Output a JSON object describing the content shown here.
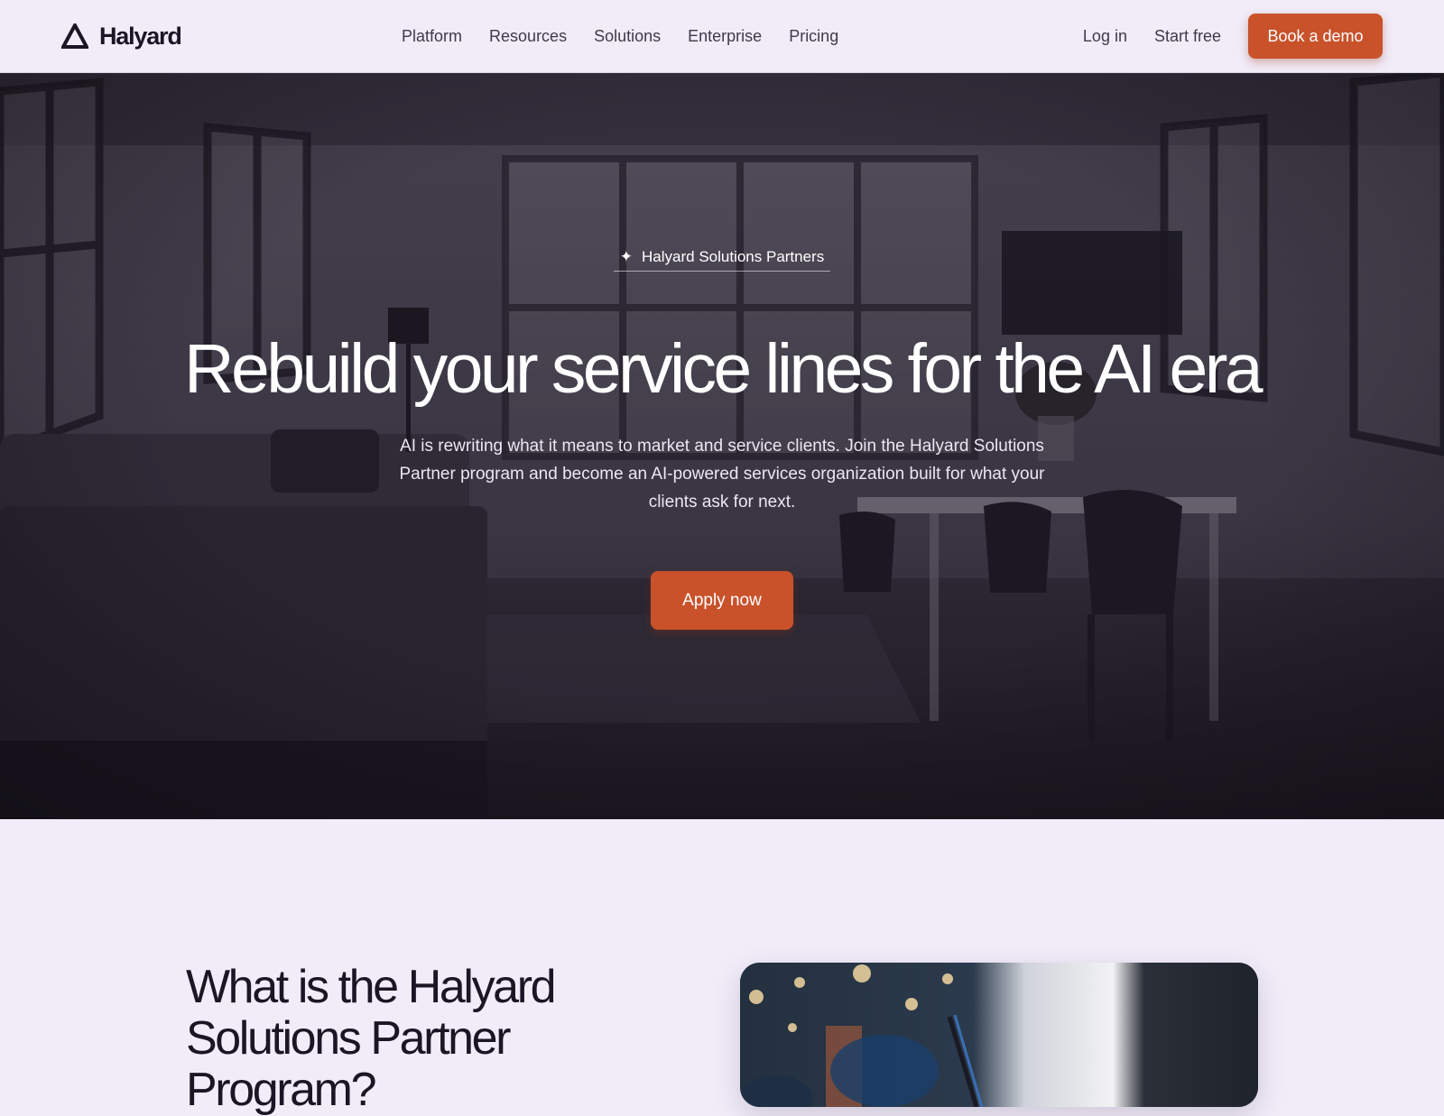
{
  "nav": {
    "brand": "Halyard",
    "links": [
      "Platform",
      "Resources",
      "Solutions",
      "Enterprise",
      "Pricing"
    ],
    "login": "Log in",
    "start_free": "Start free",
    "cta": "Book a demo"
  },
  "hero": {
    "eyebrow": "Halyard Solutions Partners",
    "title": "Rebuild your service lines for the AI era",
    "subtitle": "AI is rewriting what it means to market and service clients. Join the Halyard Solutions Partner program and become an AI-powered services organization built for what your clients ask for next.",
    "cta": "Apply now"
  },
  "section": {
    "title": "What is the Halyard Solutions Partner Program?"
  },
  "icons": {
    "logo": "triangle-logo-icon",
    "eyebrow": "sparkle-icon"
  },
  "colors": {
    "accent": "#c9522b",
    "background": "#f1ecf8",
    "text": "#1b1625"
  }
}
